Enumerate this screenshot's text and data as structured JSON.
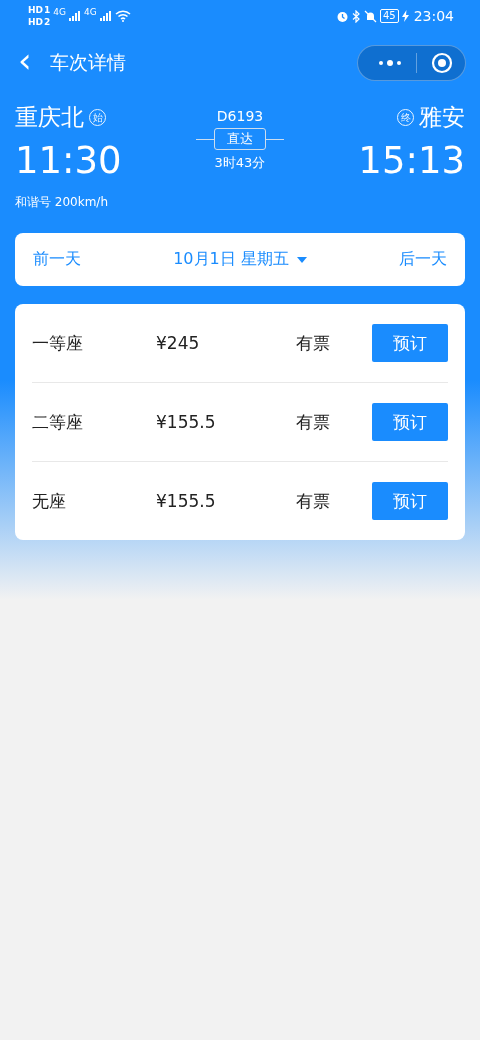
{
  "status_bar": {
    "sims": [
      {
        "badge": "HD",
        "slot": "1",
        "network": "4G"
      },
      {
        "badge": "HD",
        "slot": "2",
        "network": "4G"
      }
    ],
    "battery": "45",
    "time": "23:04"
  },
  "nav": {
    "back": "‹",
    "title": "车次详情"
  },
  "train": {
    "from": {
      "station": "重庆北",
      "tag": "始",
      "time": "11:30"
    },
    "number": "D6193",
    "type": "直达",
    "duration": "3时43分",
    "to": {
      "station": "雅安",
      "tag": "终",
      "time": "15:13"
    },
    "model": "和谐号 200km/h"
  },
  "date_bar": {
    "prev": "前一天",
    "date": "10月1日 星期五",
    "next": "后一天"
  },
  "seats": [
    {
      "name": "一等座",
      "price": "¥245",
      "availability": "有票",
      "action": "预订"
    },
    {
      "name": "二等座",
      "price": "¥155.5",
      "availability": "有票",
      "action": "预订"
    },
    {
      "name": "无座",
      "price": "¥155.5",
      "availability": "有票",
      "action": "预订"
    }
  ]
}
